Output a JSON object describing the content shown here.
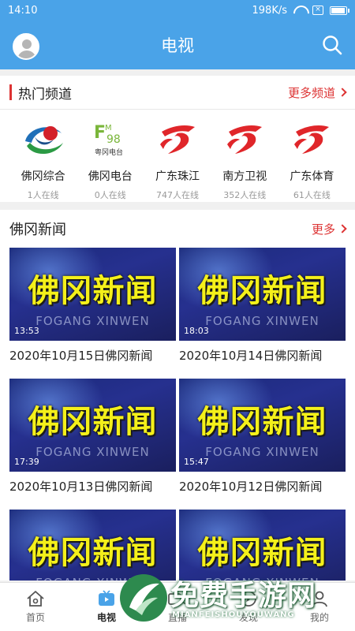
{
  "status": {
    "time": "14:10",
    "speed": "198K/s"
  },
  "appbar": {
    "title": "电视"
  },
  "hot_channels": {
    "title": "热门频道",
    "more": "更多频道",
    "items": [
      {
        "name": "佛冈综合",
        "count": "1人在线",
        "icon": "fogang-tv-logo"
      },
      {
        "name": "佛冈电台",
        "count": "0人在线",
        "icon": "fogang-radio-logo",
        "logo_text": "粤冈电台",
        "logo_num": "98"
      },
      {
        "name": "广东珠江",
        "count": "747人在线",
        "icon": "gdtv-logo"
      },
      {
        "name": "南方卫视",
        "count": "352人在线",
        "icon": "gdtv-logo"
      },
      {
        "name": "广东体育",
        "count": "61人在线",
        "icon": "gdtv-logo"
      }
    ]
  },
  "news": {
    "title": "佛冈新闻",
    "more": "更多",
    "thumb_title": "佛冈新闻",
    "thumb_sub": "FOGANG XINWEN",
    "items": [
      {
        "duration": "13:53",
        "caption": "2020年10月15日佛冈新闻"
      },
      {
        "duration": "18:03",
        "caption": "2020年10月14日佛冈新闻"
      },
      {
        "duration": "17:39",
        "caption": "2020年10月13日佛冈新闻"
      },
      {
        "duration": "15:47",
        "caption": "2020年10月12日佛冈新闻"
      },
      {
        "duration": "",
        "caption": ""
      },
      {
        "duration": "",
        "caption": ""
      }
    ]
  },
  "tabbar": {
    "tabs": [
      {
        "label": "首页",
        "icon": "home-icon"
      },
      {
        "label": "电视",
        "icon": "tv-icon",
        "active": true
      },
      {
        "label": "直播",
        "icon": "live-icon"
      },
      {
        "label": "发现",
        "icon": "discover-icon"
      },
      {
        "label": "我的",
        "icon": "profile-icon"
      }
    ]
  },
  "watermark": {
    "text": "免费手游网",
    "sub": "MIANFEISHOUYOUWANG"
  },
  "colors": {
    "primary": "#4aa3e8",
    "accent": "#d33",
    "thumb_title": "#f4f01a"
  }
}
